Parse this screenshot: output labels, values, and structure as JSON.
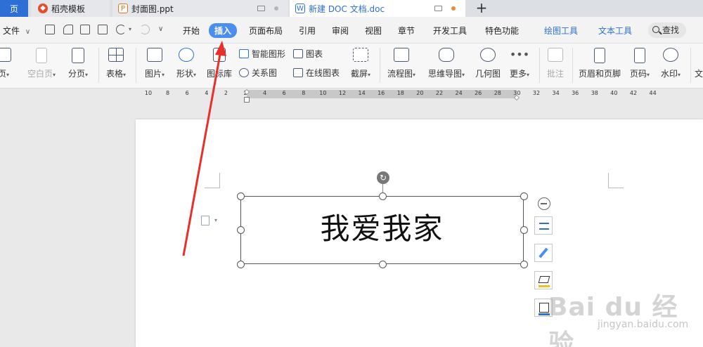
{
  "tabs": {
    "home": "页",
    "daoke": "稻壳模板",
    "ppt": "封面图.ppt",
    "doc": "新建 DOC 文档.doc",
    "new_tab": "+"
  },
  "menu": {
    "file": "文件",
    "file_caret": "∨",
    "items": [
      {
        "key": "start",
        "label": "开始"
      },
      {
        "key": "insert",
        "label": "插入"
      },
      {
        "key": "layout",
        "label": "页面布局"
      },
      {
        "key": "ref",
        "label": "引用"
      },
      {
        "key": "review",
        "label": "审阅"
      },
      {
        "key": "view",
        "label": "视图"
      },
      {
        "key": "section",
        "label": "章节"
      },
      {
        "key": "dev",
        "label": "开发工具"
      },
      {
        "key": "special",
        "label": "特色功能"
      }
    ],
    "tools": [
      {
        "key": "draw",
        "label": "绘图工具"
      },
      {
        "key": "text",
        "label": "文本工具"
      }
    ],
    "search": "查找"
  },
  "ribbon": {
    "cover_page": "页",
    "blank_page": "空白页",
    "page_break": "分页",
    "table": "表格",
    "picture": "图片",
    "shape": "形状",
    "icon_lib": "图标库",
    "smart_art": "智能图形",
    "chart": "图表",
    "relation": "关系图",
    "online_chart": "在线图表",
    "screenshot": "截屏",
    "flowchart": "流程图",
    "mindmap": "思维导图",
    "geometry": "几何图",
    "more": "更多",
    "comment": "批注",
    "header_footer": "页眉和页脚",
    "page_num": "页码",
    "watermark": "水印",
    "text_cut": "文",
    "caret": "▾"
  },
  "ruler": {
    "ticks": [
      "10",
      "8",
      "6",
      "4",
      "2",
      "2",
      "4",
      "6",
      "8",
      "10",
      "12",
      "14",
      "16",
      "18",
      "20",
      "22",
      "24",
      "26",
      "28",
      "30",
      "32",
      "34",
      "36",
      "38",
      "40",
      "42",
      "44"
    ]
  },
  "document": {
    "textbox_text": "我爱我家"
  },
  "watermark": {
    "main": "Bai du 经验",
    "sub": "jingyan.baidu.com"
  },
  "colors": {
    "accent": "#2e6fd6",
    "active_tab": "#4a8ff0",
    "arrow": "#e8302a"
  }
}
